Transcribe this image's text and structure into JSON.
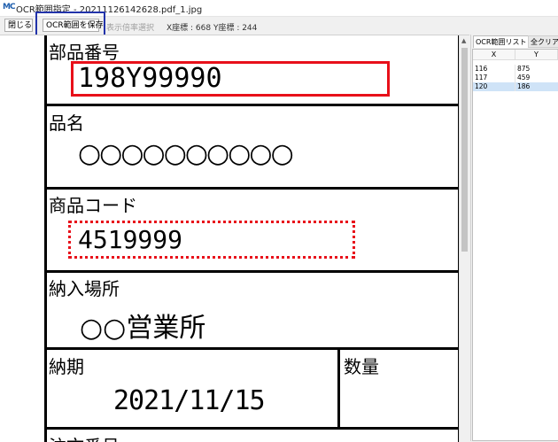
{
  "window": {
    "app_icon_text": "MC",
    "title": "OCR範囲指定 - 20211126142628.pdf_1.jpg"
  },
  "toolbar": {
    "close_label": "閉じる",
    "save_label": "OCR範囲を保存",
    "zoom_label": "表示倍率選択",
    "coords": "X座標 : 668  Y座標 : 244"
  },
  "document": {
    "part_number_label": "部品番号",
    "part_number_value": "198Y99990",
    "product_name_label": "品名",
    "product_name_value": "○○○○○○○○○○",
    "product_code_label": "商品コード",
    "product_code_value": "4519999",
    "delivery_place_label": "納入場所",
    "delivery_place_value": "○○営業所",
    "due_date_label": "納期",
    "due_date_value": "2021/11/15",
    "quantity_label": "数量",
    "order_number_label": "注文番号"
  },
  "side_panel": {
    "tab_list": "OCR範囲リスト",
    "tab_clear": "全クリア",
    "columns": [
      "X",
      "Y"
    ],
    "rows": [
      {
        "x": "116",
        "y": "875"
      },
      {
        "x": "117",
        "y": "459"
      },
      {
        "x": "120",
        "y": "186"
      }
    ]
  },
  "colors": {
    "red_highlight": "#e8101a",
    "save_highlight": "#2233aa",
    "selected_row": "#cfe3f7"
  }
}
